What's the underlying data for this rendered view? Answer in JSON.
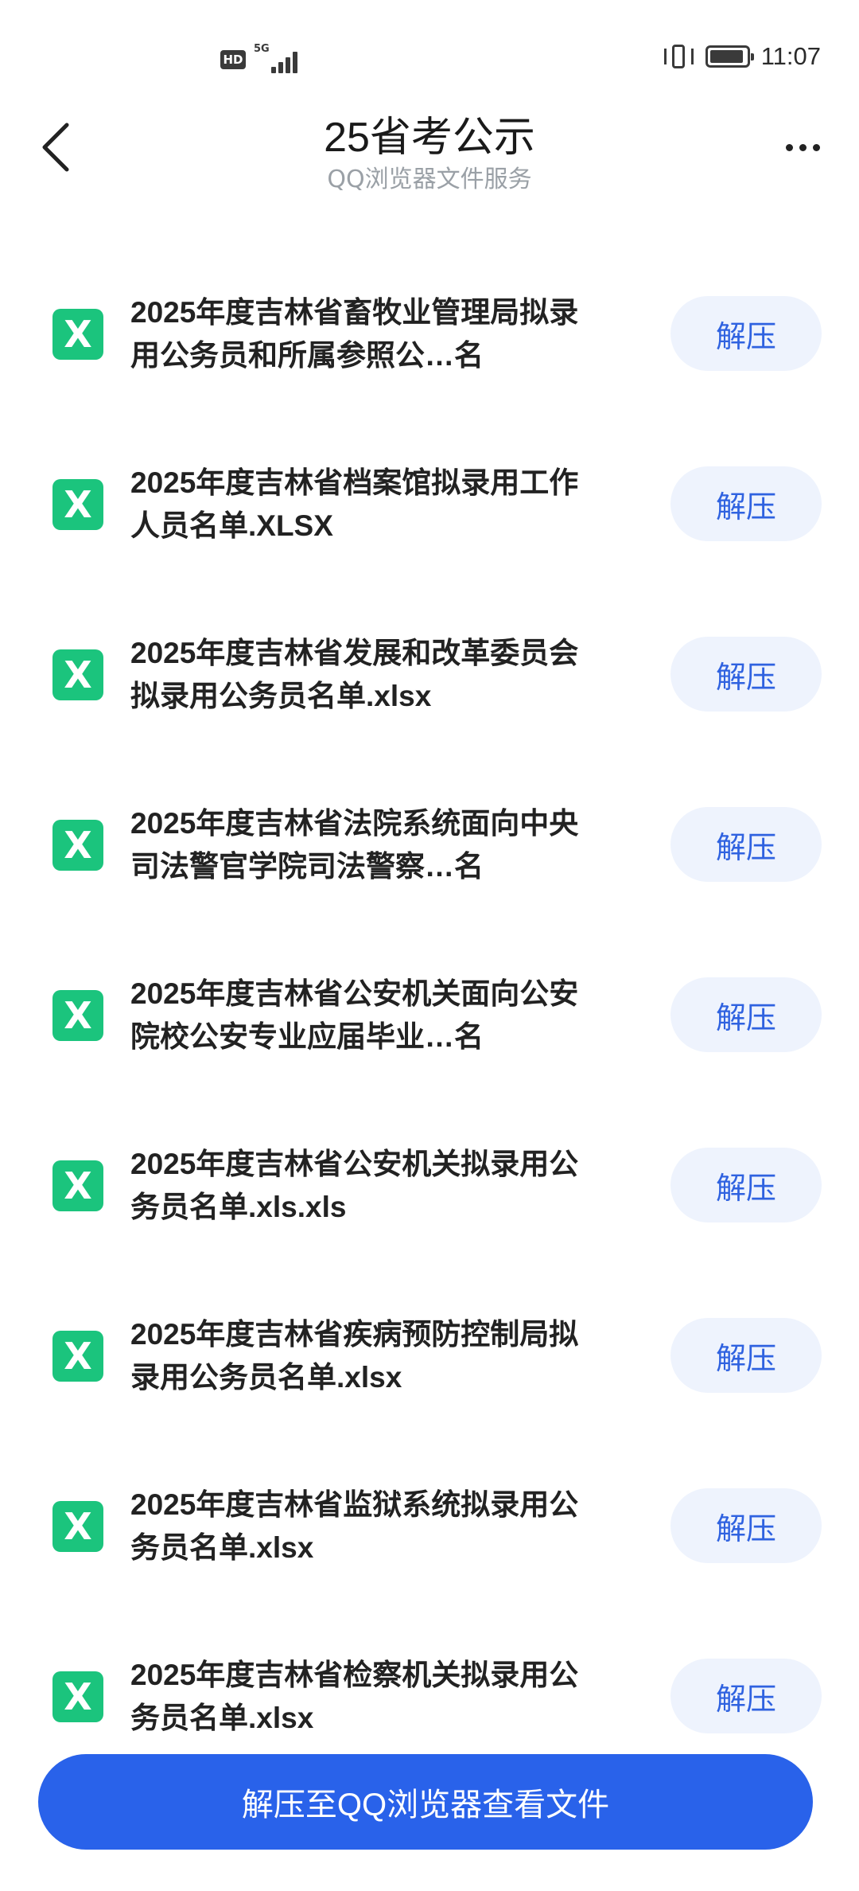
{
  "status_bar": {
    "hd_label": "HD",
    "network_label": "5G",
    "time": "11:07"
  },
  "header": {
    "title": "25省考公示",
    "subtitle": "QQ浏览器文件服务"
  },
  "files": [
    {
      "name": "2025年度吉林省畜牧业管理局拟录用公务员和所属参照公…名",
      "action": "解压"
    },
    {
      "name": "2025年度吉林省档案馆拟录用工作人员名单.XLSX",
      "action": "解压"
    },
    {
      "name": "2025年度吉林省发展和改革委员会拟录用公务员名单.xlsx",
      "action": "解压"
    },
    {
      "name": "2025年度吉林省法院系统面向中央司法警官学院司法警察…名",
      "action": "解压"
    },
    {
      "name": "2025年度吉林省公安机关面向公安院校公安专业应届毕业…名",
      "action": "解压"
    },
    {
      "name": "2025年度吉林省公安机关拟录用公务员名单.xls.xls",
      "action": "解压"
    },
    {
      "name": "2025年度吉林省疾病预防控制局拟录用公务员名单.xlsx",
      "action": "解压"
    },
    {
      "name": "2025年度吉林省监狱系统拟录用公务员名单.xlsx",
      "action": "解压"
    },
    {
      "name": "2025年度吉林省检察机关拟录用公务员名单.xlsx",
      "action": "解压"
    }
  ],
  "file_icon_letter": "X",
  "primary_action": "解压至QQ浏览器查看文件",
  "colors": {
    "accent": "#2962ea",
    "button_bg": "#eef3fd",
    "button_text": "#2f62e0",
    "excel_icon": "#1bc47d"
  },
  "icons": {
    "back": "chevron-left-icon",
    "more": "more-horizontal-icon",
    "file": "excel-file-icon"
  }
}
